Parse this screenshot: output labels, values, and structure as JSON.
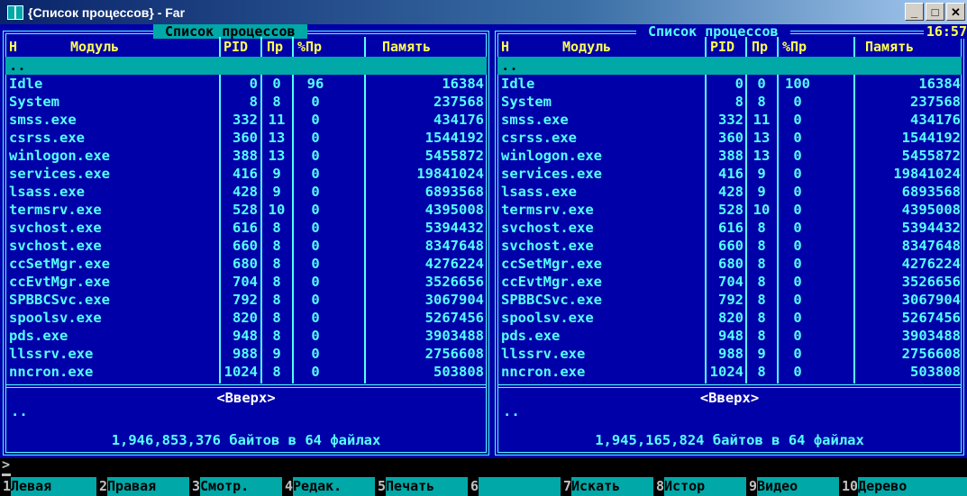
{
  "window": {
    "title": "{Список процессов} - Far",
    "buttons": [
      "_",
      "□",
      "✕"
    ]
  },
  "columns": [
    "Н",
    "Модуль",
    "PID",
    "Пр",
    "%Пр",
    "Память"
  ],
  "left_panel": {
    "title": " Список процессов ",
    "up_label": "<Вверх>",
    "parent": "..",
    "summary": " 1,946,853,376 байтов в 64 файлах ",
    "rows": [
      {
        "name": "..",
        "pid": "",
        "pr": "",
        "cpu": "",
        "mem": ""
      },
      {
        "name": "Idle",
        "pid": "0",
        "pr": "0",
        "cpu": "96",
        "mem": "16384"
      },
      {
        "name": "System",
        "pid": "8",
        "pr": "8",
        "cpu": "0",
        "mem": "237568"
      },
      {
        "name": "smss.exe",
        "pid": "332",
        "pr": "11",
        "cpu": "0",
        "mem": "434176"
      },
      {
        "name": "csrss.exe",
        "pid": "360",
        "pr": "13",
        "cpu": "0",
        "mem": "1544192"
      },
      {
        "name": "winlogon.exe",
        "pid": "388",
        "pr": "13",
        "cpu": "0",
        "mem": "5455872"
      },
      {
        "name": "services.exe",
        "pid": "416",
        "pr": "9",
        "cpu": "0",
        "mem": "19841024"
      },
      {
        "name": "lsass.exe",
        "pid": "428",
        "pr": "9",
        "cpu": "0",
        "mem": "6893568"
      },
      {
        "name": "termsrv.exe",
        "pid": "528",
        "pr": "10",
        "cpu": "0",
        "mem": "4395008"
      },
      {
        "name": "svchost.exe",
        "pid": "616",
        "pr": "8",
        "cpu": "0",
        "mem": "5394432"
      },
      {
        "name": "svchost.exe",
        "pid": "660",
        "pr": "8",
        "cpu": "0",
        "mem": "8347648"
      },
      {
        "name": "ccSetMgr.exe",
        "pid": "680",
        "pr": "8",
        "cpu": "0",
        "mem": "4276224"
      },
      {
        "name": "ccEvtMgr.exe",
        "pid": "704",
        "pr": "8",
        "cpu": "0",
        "mem": "3526656"
      },
      {
        "name": "SPBBCSvc.exe",
        "pid": "792",
        "pr": "8",
        "cpu": "0",
        "mem": "3067904"
      },
      {
        "name": "spoolsv.exe",
        "pid": "820",
        "pr": "8",
        "cpu": "0",
        "mem": "5267456"
      },
      {
        "name": "pds.exe",
        "pid": "948",
        "pr": "8",
        "cpu": "0",
        "mem": "3903488"
      },
      {
        "name": "llssrv.exe",
        "pid": "988",
        "pr": "9",
        "cpu": "0",
        "mem": "2756608"
      },
      {
        "name": "nncron.exe",
        "pid": "1024",
        "pr": "8",
        "cpu": "0",
        "mem": "503808"
      }
    ]
  },
  "right_panel": {
    "title": " Список процессов ",
    "clock": "16:57",
    "up_label": "<Вверх>",
    "summary": " 1,945,165,824 байтов в 64 файлах ",
    "rows": [
      {
        "name": "..",
        "pid": "",
        "pr": "",
        "cpu": "",
        "mem": ""
      },
      {
        "name": "Idle",
        "pid": "0",
        "pr": "0",
        "cpu": "100",
        "mem": "16384"
      },
      {
        "name": "System",
        "pid": "8",
        "pr": "8",
        "cpu": "0",
        "mem": "237568"
      },
      {
        "name": "smss.exe",
        "pid": "332",
        "pr": "11",
        "cpu": "0",
        "mem": "434176"
      },
      {
        "name": "csrss.exe",
        "pid": "360",
        "pr": "13",
        "cpu": "0",
        "mem": "1544192"
      },
      {
        "name": "winlogon.exe",
        "pid": "388",
        "pr": "13",
        "cpu": "0",
        "mem": "5455872"
      },
      {
        "name": "services.exe",
        "pid": "416",
        "pr": "9",
        "cpu": "0",
        "mem": "19841024"
      },
      {
        "name": "lsass.exe",
        "pid": "428",
        "pr": "9",
        "cpu": "0",
        "mem": "6893568"
      },
      {
        "name": "termsrv.exe",
        "pid": "528",
        "pr": "10",
        "cpu": "0",
        "mem": "4395008"
      },
      {
        "name": "svchost.exe",
        "pid": "616",
        "pr": "8",
        "cpu": "0",
        "mem": "5394432"
      },
      {
        "name": "svchost.exe",
        "pid": "660",
        "pr": "8",
        "cpu": "0",
        "mem": "8347648"
      },
      {
        "name": "ccSetMgr.exe",
        "pid": "680",
        "pr": "8",
        "cpu": "0",
        "mem": "4276224"
      },
      {
        "name": "ccEvtMgr.exe",
        "pid": "704",
        "pr": "8",
        "cpu": "0",
        "mem": "3526656"
      },
      {
        "name": "SPBBCSvc.exe",
        "pid": "792",
        "pr": "8",
        "cpu": "0",
        "mem": "3067904"
      },
      {
        "name": "spoolsv.exe",
        "pid": "820",
        "pr": "8",
        "cpu": "0",
        "mem": "5267456"
      },
      {
        "name": "pds.exe",
        "pid": "948",
        "pr": "8",
        "cpu": "0",
        "mem": "3903488"
      },
      {
        "name": "llssrv.exe",
        "pid": "988",
        "pr": "9",
        "cpu": "0",
        "mem": "2756608"
      },
      {
        "name": "nncron.exe",
        "pid": "1024",
        "pr": "8",
        "cpu": "0",
        "mem": "503808"
      }
    ]
  },
  "command_line": {
    "prompt": ">",
    "value": ""
  },
  "keybar": [
    {
      "num": "1",
      "label": "Левая"
    },
    {
      "num": "2",
      "label": "Правая"
    },
    {
      "num": "3",
      "label": "Смотр."
    },
    {
      "num": "4",
      "label": "Редак."
    },
    {
      "num": "5",
      "label": "Печать"
    },
    {
      "num": "6",
      "label": ""
    },
    {
      "num": "7",
      "label": "Искать"
    },
    {
      "num": "8",
      "label": "Истор"
    },
    {
      "num": "9",
      "label": "Видео"
    },
    {
      "num": "10",
      "label": "Дерево"
    }
  ],
  "colors": {
    "panel_bg": "#0000a8",
    "panel_text": "#55ffff",
    "header_text": "#ffff55",
    "cursor_bg": "#00a8a8",
    "keybar_bg": "#00a8a8"
  }
}
